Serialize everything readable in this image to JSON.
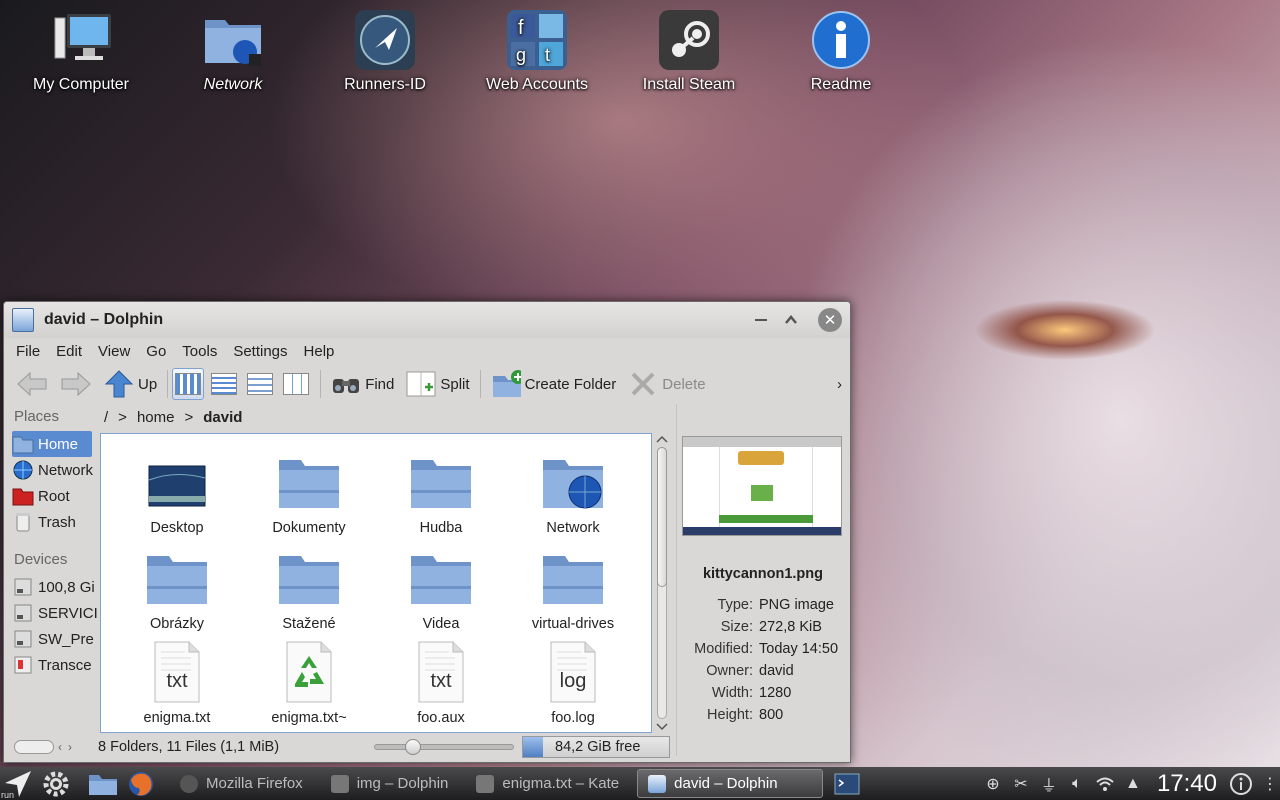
{
  "desktop": {
    "icons": [
      {
        "label": "My Computer",
        "icon": "computer-icon"
      },
      {
        "label": "Network",
        "icon": "network-folder-icon"
      },
      {
        "label": "Runners-ID",
        "icon": "runners-id-icon"
      },
      {
        "label": "Web Accounts",
        "icon": "web-accounts-icon"
      },
      {
        "label": "Install Steam",
        "icon": "steam-icon"
      },
      {
        "label": "Readme",
        "icon": "info-icon"
      }
    ]
  },
  "window": {
    "title": "david – Dolphin",
    "menu": [
      "File",
      "Edit",
      "View",
      "Go",
      "Tools",
      "Settings",
      "Help"
    ],
    "toolbar": {
      "up": "Up",
      "find": "Find",
      "split": "Split",
      "create_folder": "Create Folder",
      "delete": "Delete",
      "more": "›"
    },
    "places": {
      "heading": "Places",
      "items": [
        "Home",
        "Network",
        "Root",
        "Trash"
      ],
      "devices_heading": "Devices",
      "devices": [
        "100,8 Gi",
        "SERVICI",
        "SW_Pre",
        "Transce"
      ]
    },
    "breadcrumb": {
      "root": "/",
      "sep": ">",
      "home": "home",
      "current": "david"
    },
    "files": [
      {
        "name": "Desktop",
        "kind": "desktop"
      },
      {
        "name": "Dokumenty",
        "kind": "folder"
      },
      {
        "name": "Hudba",
        "kind": "folder"
      },
      {
        "name": "Network",
        "kind": "network"
      },
      {
        "name": "Obrázky",
        "kind": "folder"
      },
      {
        "name": "Stažené",
        "kind": "folder"
      },
      {
        "name": "Videa",
        "kind": "folder"
      },
      {
        "name": "virtual-drives",
        "kind": "folder"
      },
      {
        "name": "enigma.txt",
        "kind": "txt",
        "ext": "txt"
      },
      {
        "name": "enigma.txt~",
        "kind": "backup"
      },
      {
        "name": "foo.aux",
        "kind": "txt",
        "ext": "txt"
      },
      {
        "name": "foo.log",
        "kind": "txt",
        "ext": "log"
      }
    ],
    "info": {
      "filename": "kittycannon1.png",
      "rows": [
        {
          "k": "Type:",
          "v": "PNG image"
        },
        {
          "k": "Size:",
          "v": "272,8 KiB"
        },
        {
          "k": "Modified:",
          "v": "Today 14:50"
        },
        {
          "k": "Owner:",
          "v": "david"
        },
        {
          "k": "Width:",
          "v": "1280"
        },
        {
          "k": "Height:",
          "v": "800"
        }
      ]
    },
    "status": {
      "summary": "8 Folders, 11 Files (1,1 MiB)",
      "free": "84,2 GiB free"
    }
  },
  "taskbar": {
    "launcher_label": "run",
    "tasks": [
      {
        "label": "Mozilla Firefox",
        "active": false
      },
      {
        "label": "img – Dolphin",
        "active": false
      },
      {
        "label": "enigma.txt – Kate",
        "active": false
      },
      {
        "label": "david – Dolphin",
        "active": true
      }
    ],
    "clock": "17:40"
  }
}
